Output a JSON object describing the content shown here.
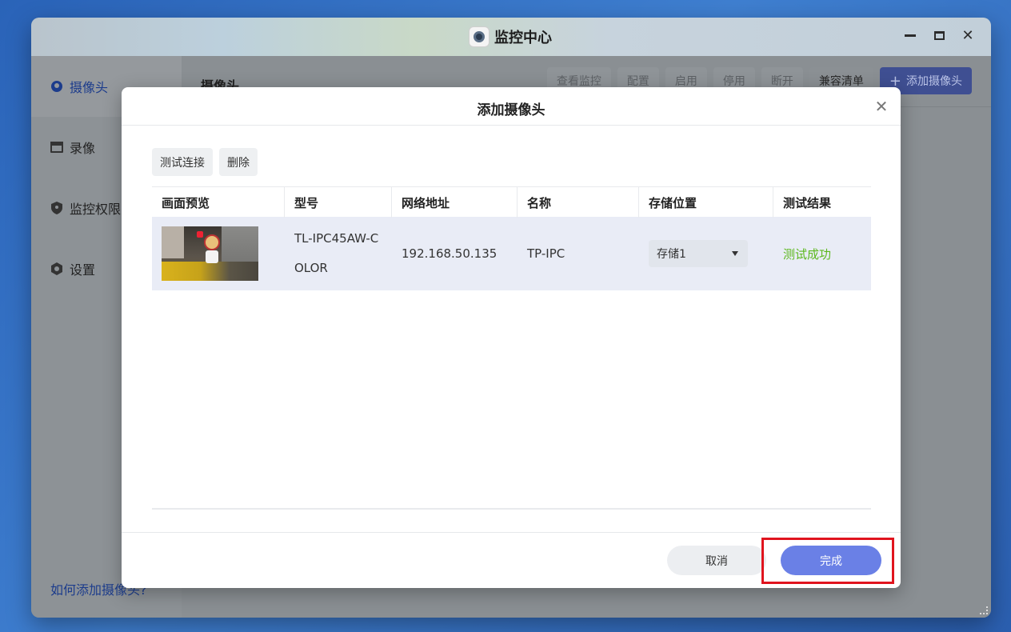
{
  "window": {
    "title": "监控中心"
  },
  "sidebar": {
    "items": [
      {
        "label": "摄像头",
        "icon": "camera-icon",
        "active": true
      },
      {
        "label": "录像",
        "icon": "film-icon",
        "active": false
      },
      {
        "label": "监控权限",
        "icon": "shield-icon",
        "active": false
      },
      {
        "label": "设置",
        "icon": "gear-icon",
        "active": false
      }
    ],
    "help_link": "如何添加摄像头?"
  },
  "main": {
    "title": "摄像头",
    "toolbar": [
      "查看监控",
      "配置",
      "启用",
      "停用",
      "断开",
      "兼容清单"
    ],
    "add_button": "添加摄像头"
  },
  "modal": {
    "title": "添加摄像头",
    "actions": {
      "test": "测试连接",
      "delete": "删除"
    },
    "columns": [
      "画面预览",
      "型号",
      "网络地址",
      "名称",
      "存储位置",
      "测试结果"
    ],
    "rows": [
      {
        "model": "TL-IPC45AW-COLOR",
        "ip": "192.168.50.135",
        "name": "TP-IPC",
        "storage": "存储1",
        "result": "测试成功"
      }
    ],
    "footer": {
      "cancel": "取消",
      "done": "完成"
    }
  },
  "colors": {
    "accent": "#6a80e6",
    "success": "#5cb81d",
    "highlight": "#e0141e"
  }
}
